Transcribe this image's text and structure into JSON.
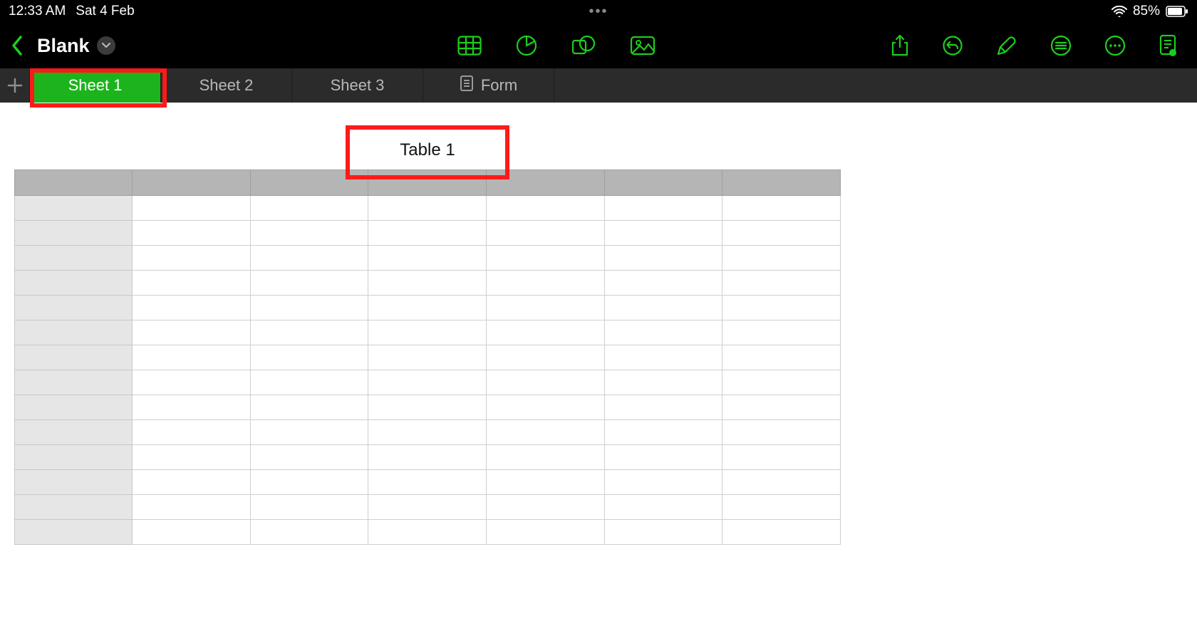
{
  "status": {
    "time": "12:33 AM",
    "date": "Sat 4 Feb",
    "battery_pct": "85%"
  },
  "header": {
    "doc_title": "Blank"
  },
  "insert_icons": [
    "table",
    "chart",
    "shape",
    "image"
  ],
  "action_icons": [
    "share",
    "undo",
    "format-brush",
    "view-options",
    "more",
    "track"
  ],
  "tabs": {
    "items": [
      {
        "label": "Sheet 1",
        "active": true,
        "icon": null
      },
      {
        "label": "Sheet 2",
        "active": false,
        "icon": null
      },
      {
        "label": "Sheet 3",
        "active": false,
        "icon": null
      },
      {
        "label": "Form",
        "active": false,
        "icon": "form"
      }
    ]
  },
  "table": {
    "title": "Table 1",
    "columns": 7,
    "rows": 14
  },
  "highlights": [
    "active-sheet-tab",
    "table-title"
  ],
  "accent_color": "#1cce1c"
}
